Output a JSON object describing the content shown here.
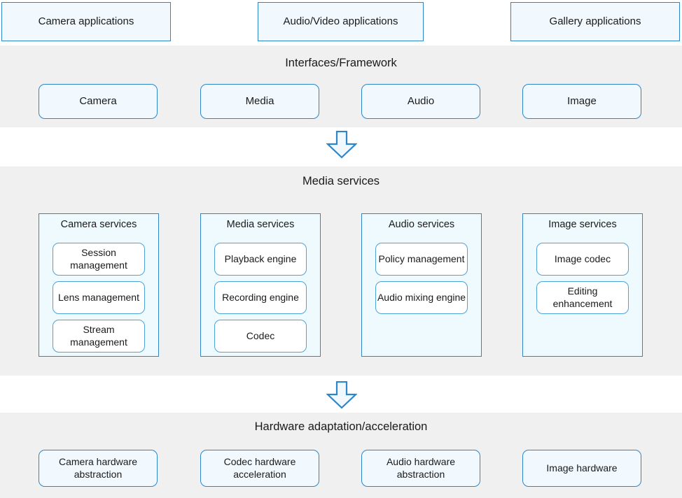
{
  "colors": {
    "border": "#2E86C8",
    "inner_border": "#4DA3D8",
    "band_fill": "#F0F0F0",
    "box_fill": "#F2F9FE",
    "group_fill": "#EFFAFF",
    "item_fill": "#FFFFFF",
    "text": "#1A1A1A"
  },
  "applications": {
    "camera": "Camera applications",
    "audio_video": "Audio/Video applications",
    "gallery": "Gallery applications"
  },
  "interfaces": {
    "title": "Interfaces/Framework",
    "boxes": [
      {
        "label": "Camera"
      },
      {
        "label": "Media"
      },
      {
        "label": "Audio"
      },
      {
        "label": "Image"
      }
    ]
  },
  "arrows": {
    "top": "down-arrow",
    "bottom": "down-arrow"
  },
  "services": {
    "title": "Media services",
    "groups": [
      {
        "title": "Camera services",
        "items": [
          {
            "label": "Session management"
          },
          {
            "label": "Lens management"
          },
          {
            "label": "Stream management"
          }
        ]
      },
      {
        "title": "Media services",
        "items": [
          {
            "label": "Playback engine"
          },
          {
            "label": "Recording engine"
          },
          {
            "label": "Codec"
          }
        ]
      },
      {
        "title": "Audio services",
        "items": [
          {
            "label": "Policy management"
          },
          {
            "label": "Audio mixing engine"
          }
        ]
      },
      {
        "title": "Image services",
        "items": [
          {
            "label": "Image codec"
          },
          {
            "label": "Editing enhancement"
          }
        ]
      }
    ]
  },
  "hardware": {
    "title": "Hardware adaptation/acceleration",
    "boxes": [
      {
        "label": "Camera hardware abstraction"
      },
      {
        "label": "Codec hardware acceleration"
      },
      {
        "label": "Audio hardware abstraction"
      },
      {
        "label": "Image hardware"
      }
    ]
  }
}
